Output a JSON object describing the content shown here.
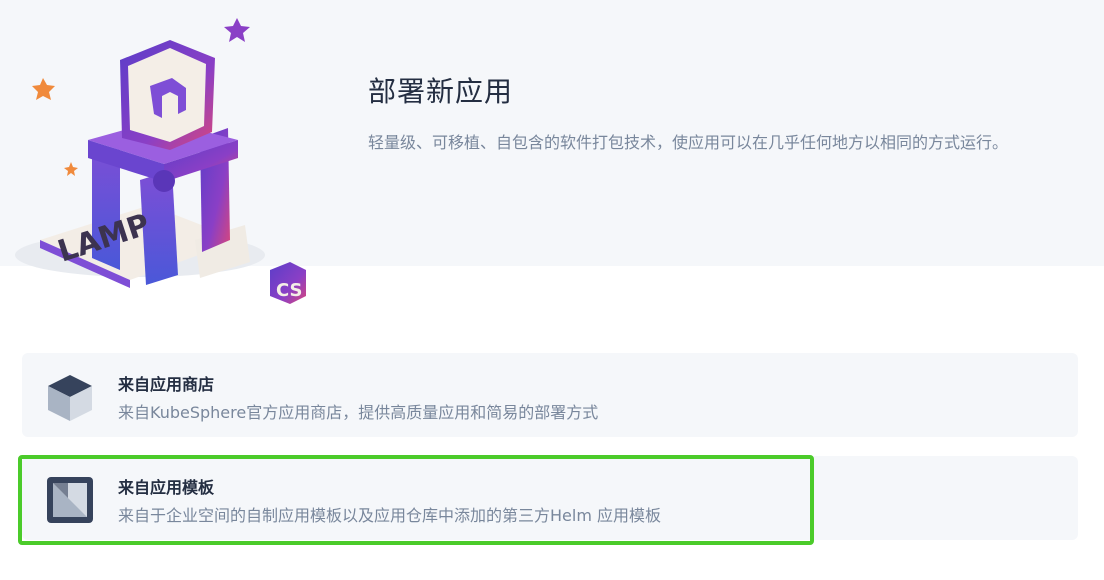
{
  "hero": {
    "title": "部署新应用",
    "description": "轻量级、可移植、自包含的软件打包技术，使应用可以在几乎任何地方以相同的方式运行。",
    "illustration_icon": "lamp-stack-illustration",
    "illustration_text": "LAMP",
    "badge_text": "CS"
  },
  "options": [
    {
      "title": "来自应用商店",
      "description": "来自KubeSphere官方应用商店，提供高质量应用和简易的部署方式",
      "icon": "cube-icon"
    },
    {
      "title": "来自应用模板",
      "description": "来自于企业空间的自制应用模板以及应用仓库中添加的第三方Helm 应用模板",
      "icon": "template-icon",
      "highlighted": true
    }
  ],
  "colors": {
    "hero_bg": "#f5f7fa",
    "card_bg": "#f5f7fa",
    "title": "#242e42",
    "text_secondary": "#79879c",
    "highlight": "#4bcb2a",
    "accent_purple": "#7b4ad1"
  }
}
